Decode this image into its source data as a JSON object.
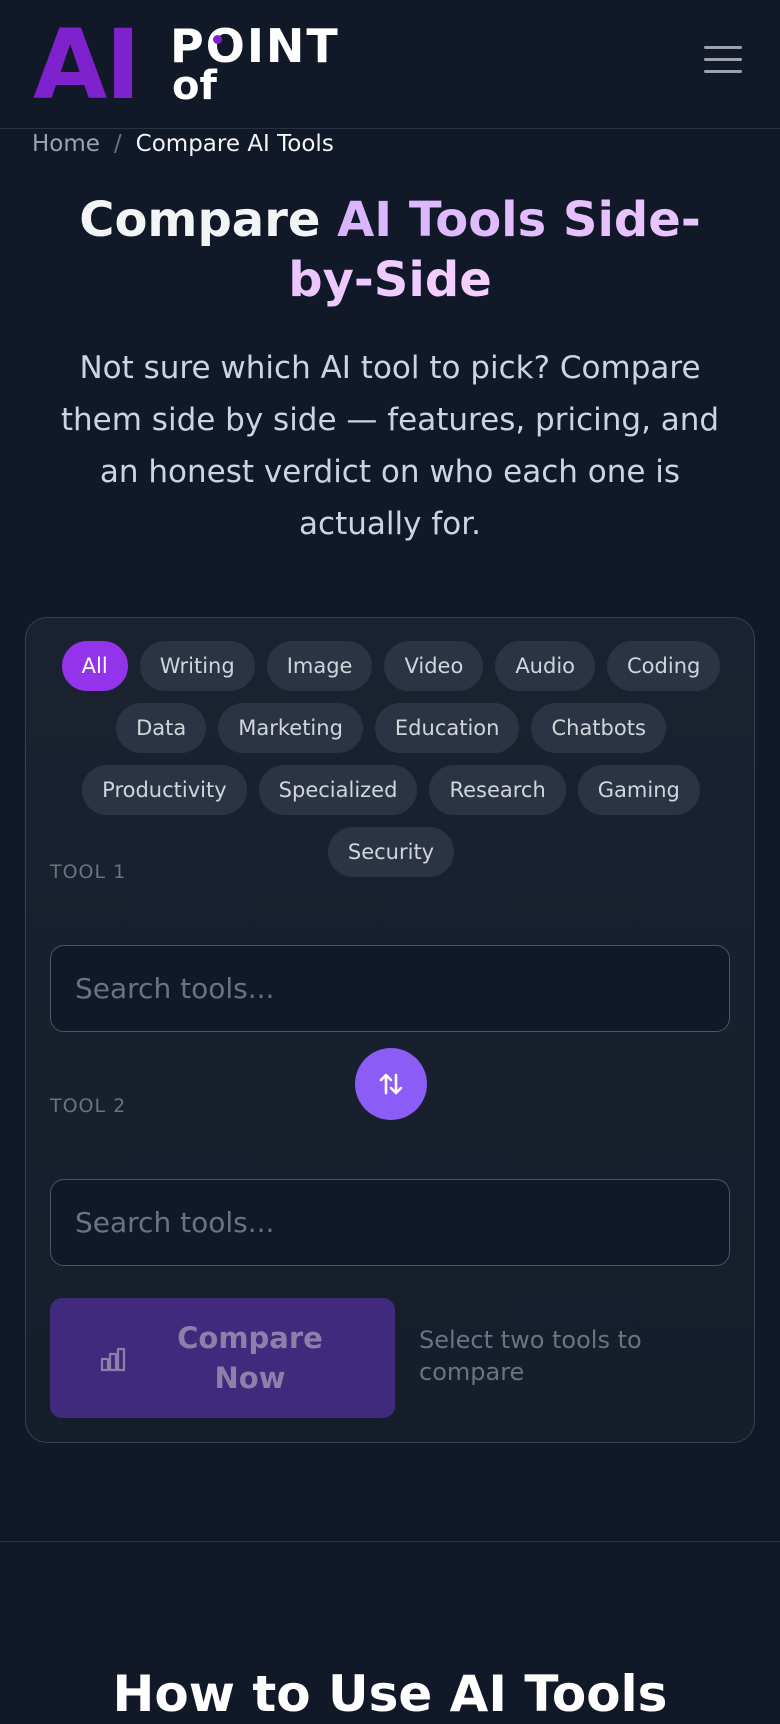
{
  "logo": {
    "ai": "AI",
    "point": "POINT",
    "of": "of"
  },
  "breadcrumb": {
    "home": "Home",
    "separator": "/",
    "current": "Compare AI Tools"
  },
  "hero": {
    "title_plain": "Compare ",
    "title_highlight": "AI Tools Side-by-Side",
    "subtitle": "Not sure which AI tool to pick? Compare them side by side — features, pricing, and an honest verdict on who each one is actually for."
  },
  "categories": [
    "All",
    "Writing",
    "Image",
    "Video",
    "Audio",
    "Coding",
    "Data",
    "Marketing",
    "Education",
    "Chatbots",
    "Productivity",
    "Specialized",
    "Research",
    "Gaming",
    "Security"
  ],
  "active_category": "All",
  "tool1": {
    "label": "TOOL 1",
    "placeholder": "Search tools...",
    "value": ""
  },
  "tool2": {
    "label": "TOOL 2",
    "placeholder": "Search tools...",
    "value": ""
  },
  "compare": {
    "button_label": "Compare Now",
    "hint": "Select two tools to compare"
  },
  "next_section": {
    "heading": "How to Use AI Tools"
  },
  "colors": {
    "background": "#111827",
    "accent": "#9333ea",
    "swap": "#8b5cf6",
    "logo": "#7e22ce"
  },
  "icons": {
    "menu": "hamburger-icon",
    "swap": "swap-arrows-icon",
    "compare": "bar-chart-icon"
  }
}
